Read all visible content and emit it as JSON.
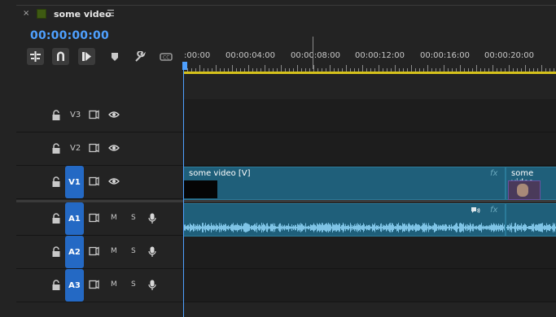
{
  "panel": {
    "tab_close": "×",
    "tab_title": "some video",
    "menu_icon": "hamburger-menu-icon",
    "timecode": "00:00:00:00"
  },
  "toolbar": {
    "tools": [
      "insert-sequence-icon",
      "snap-magnet-icon",
      "linked-selection-icon",
      "add-marker-icon",
      "settings-wrench-icon",
      "captions-icon"
    ]
  },
  "ruler": {
    "labels": [
      ":00:00",
      "00:00:04:00",
      "00:00:08:00",
      "00:00:12:00",
      "00:00:16:00",
      "00:00:20:00"
    ]
  },
  "video_tracks": [
    {
      "name": "V3",
      "target": false
    },
    {
      "name": "V2",
      "target": false
    },
    {
      "name": "V1",
      "target": true
    }
  ],
  "audio_tracks": [
    {
      "name": "A1",
      "mute": "M",
      "solo": "S"
    },
    {
      "name": "A2",
      "mute": "M",
      "solo": "S"
    },
    {
      "name": "A3",
      "mute": "M",
      "solo": "S"
    }
  ],
  "clips": {
    "video_1": {
      "name": "some video [V]",
      "fx": "fx"
    },
    "video_2": {
      "name": "some video"
    },
    "audio_1": {
      "fx": "fx"
    },
    "audio_2": {
      "fx": "fx"
    }
  },
  "colors": {
    "timecode": "#4ea0ff",
    "target_track": "#2469c4",
    "clip": "#1f5f7a",
    "work_area": "#d6c21b"
  }
}
